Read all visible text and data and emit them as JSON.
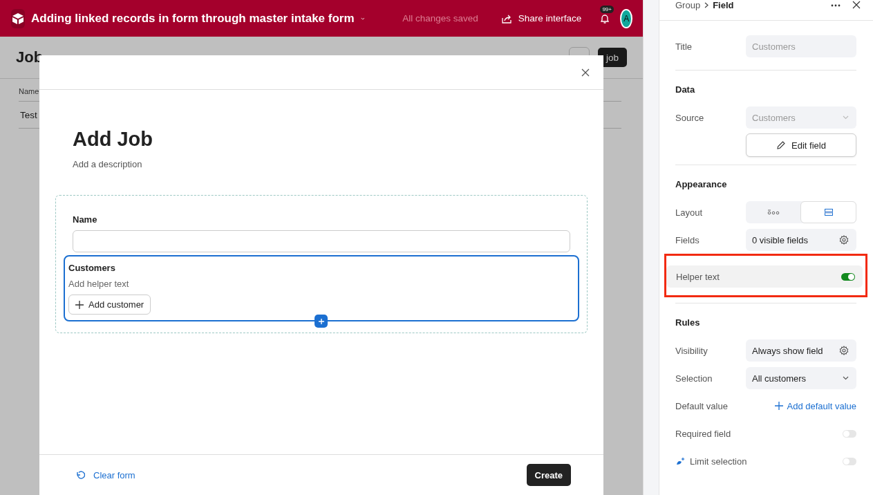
{
  "app_bar": {
    "title": "Adding linked records in form through master intake form",
    "save_status": "All changes saved",
    "share": "Share interface",
    "notifications": "99+",
    "avatar": "A"
  },
  "page": {
    "title": "Job",
    "add_button": "job",
    "table": {
      "columns": [
        "Name"
      ],
      "rows": [
        [
          "Test"
        ]
      ]
    }
  },
  "modal": {
    "title": "Add Job",
    "description": "Add a description",
    "fields": [
      {
        "kind": "text",
        "label": "Name",
        "selected": false
      },
      {
        "kind": "linked",
        "label": "Customers",
        "helper": "Add helper text",
        "button": "Add customer",
        "selected": true
      }
    ],
    "clear": "Clear form",
    "submit": "Create"
  },
  "panel": {
    "breadcrumb": [
      "Group",
      "Field"
    ],
    "title_row": {
      "label": "Title",
      "placeholder": "Customers"
    },
    "sections": [
      {
        "heading": "Data",
        "rows": [
          {
            "kind": "select",
            "label": "Source",
            "value": "Customers",
            "disabled": true
          },
          {
            "kind": "button",
            "value": "Edit field"
          }
        ]
      },
      {
        "heading": "Appearance",
        "rows": [
          {
            "kind": "segmented",
            "label": "Layout",
            "options": [
              {
                "selected": false
              },
              {
                "selected": true
              }
            ]
          },
          {
            "kind": "gear",
            "label": "Fields",
            "value": "0 visible fields"
          },
          {
            "kind": "toggle",
            "label": "Helper text",
            "on": true,
            "highlighted": true
          }
        ]
      },
      {
        "heading": "Rules",
        "rows": [
          {
            "kind": "gear",
            "label": "Visibility",
            "value": "Always show field"
          },
          {
            "kind": "select",
            "label": "Selection",
            "value": "All customers",
            "disabled": false
          },
          {
            "kind": "link",
            "label": "Default value",
            "value": "Add default value"
          },
          {
            "kind": "toggle",
            "label": "Required field",
            "on": false,
            "highlighted": false
          },
          {
            "kind": "toggle",
            "label": "Limit selection",
            "on": false,
            "highlighted": false,
            "sparkle": true
          }
        ]
      }
    ]
  }
}
